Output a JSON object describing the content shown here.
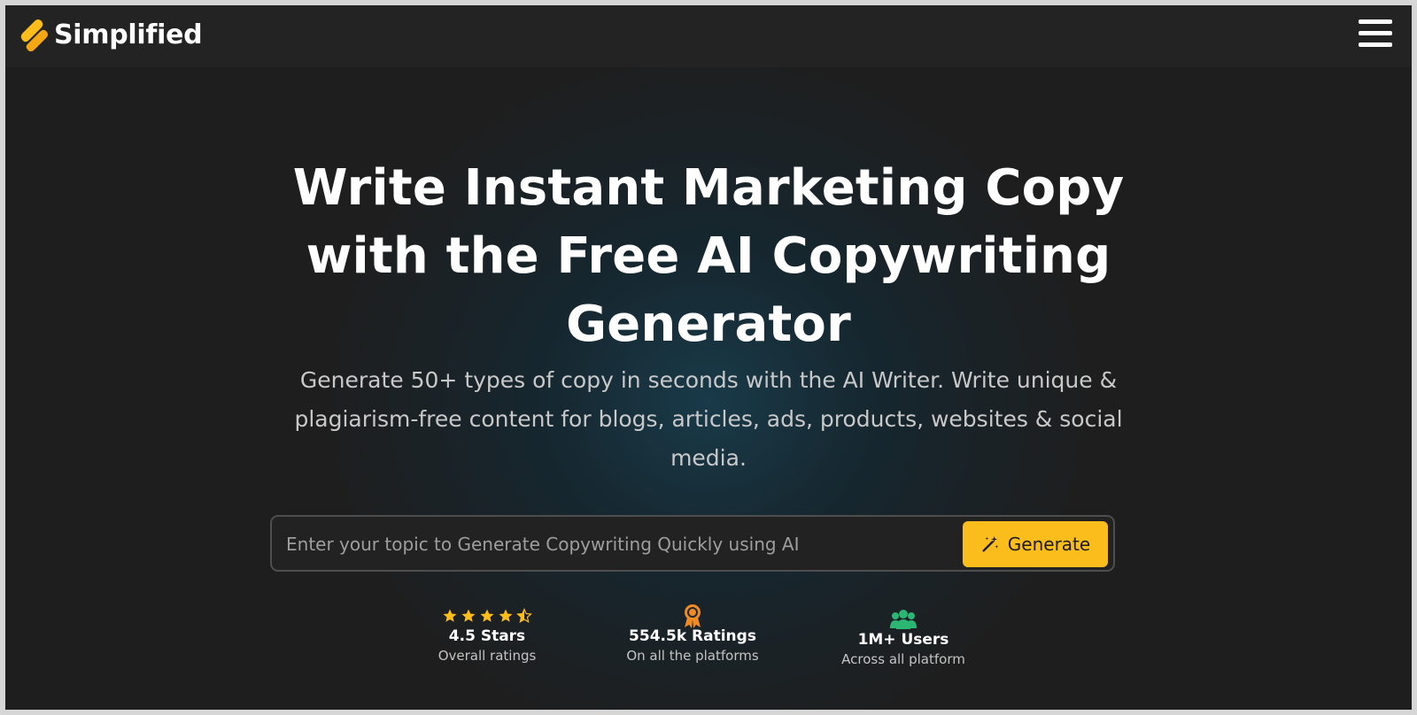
{
  "brand": {
    "name": "Simplified"
  },
  "nav": {
    "menu_icon": "hamburger-menu-icon"
  },
  "hero": {
    "headline": "Write Instant Marketing Copy with the Free AI Copywriting Generator",
    "subheadline": "Generate 50+ types of copy in seconds with the AI Writer. Write unique & plagiarism-free content for blogs, articles, ads, products, websites & social media."
  },
  "search": {
    "placeholder": "Enter your topic to Generate Copywriting Quickly using AI",
    "value": "",
    "button_label": "Generate"
  },
  "stats": [
    {
      "icon": "star-rating-icon",
      "rating": 4.5,
      "title": "4.5 Stars",
      "subtitle": "Overall ratings"
    },
    {
      "icon": "award-ribbon-icon",
      "title": "554.5k Ratings",
      "subtitle": "On all the platforms"
    },
    {
      "icon": "users-group-icon",
      "title": "1M+ Users",
      "subtitle": "Across all platform"
    }
  ],
  "colors": {
    "accent": "#fbbd1b",
    "page_bg": "#1f1f1f",
    "nav_bg": "#232323",
    "star": "#fbbd1b",
    "award": "#f08a24",
    "users": "#2bb673"
  }
}
